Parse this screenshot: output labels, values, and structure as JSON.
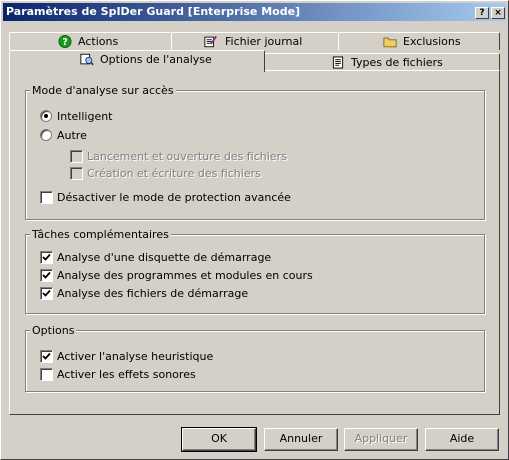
{
  "window": {
    "title": "Paramètres de SpIDer Guard [Enterprise Mode]",
    "help_glyph": "?",
    "close_glyph": "×"
  },
  "tabs_back": [
    {
      "label": "Actions",
      "icon": "help-circle-icon"
    },
    {
      "label": "Fichier journal",
      "icon": "log-file-icon"
    },
    {
      "label": "Exclusions",
      "icon": "folder-icon"
    }
  ],
  "tabs_front": [
    {
      "label": "Options de l'analyse",
      "icon": "scan-options-icon",
      "active": true
    },
    {
      "label": "Types de fichiers",
      "icon": "file-types-icon",
      "active": false
    }
  ],
  "scan_mode": {
    "title": "Mode d'analyse sur accès",
    "intelligent": {
      "label": "Intelligent",
      "selected": true
    },
    "other": {
      "label": "Autre",
      "selected": false
    },
    "launch_open": {
      "label": "Lancement et ouverture des fichiers",
      "checked": false,
      "disabled": true
    },
    "create_write": {
      "label": "Création et écriture des fichiers",
      "checked": false,
      "disabled": true
    },
    "disable_advanced": {
      "label": "Désactiver le mode de protection avancée",
      "checked": false
    }
  },
  "extra_tasks": {
    "title": "Tâches complémentaires",
    "items": [
      {
        "label": "Analyse d'une disquette de démarrage",
        "checked": true
      },
      {
        "label": "Analyse des programmes et modules en cours",
        "checked": true
      },
      {
        "label": "Analyse des fichiers de démarrage",
        "checked": true
      }
    ]
  },
  "options": {
    "title": "Options",
    "items": [
      {
        "label": "Activer l'analyse heuristique",
        "checked": true
      },
      {
        "label": "Activer les effets sonores",
        "checked": false
      }
    ]
  },
  "buttons": {
    "ok": "OK",
    "cancel": "Annuler",
    "apply": "Appliquer",
    "help": "Aide"
  },
  "colors": {
    "face": "#d4d0c8",
    "title_start": "#0a246a",
    "title_end": "#a6caf0",
    "help_icon_green": "#1a9a1a"
  }
}
